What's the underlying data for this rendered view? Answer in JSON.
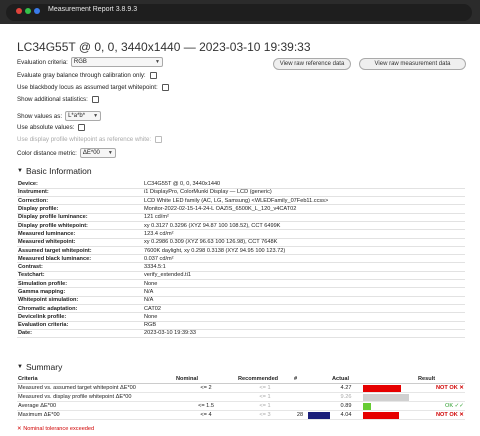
{
  "window": {
    "title": "Measurement Report 3.8.9.3"
  },
  "report_heading": "LC34G55T @ 0, 0, 3440x1440 — 2023-03-10 19:39:33",
  "controls": {
    "evaluation_criteria_label": "Evaluation criteria:",
    "evaluation_criteria_value": "RGB",
    "gray_balance_label": "Evaluate gray balance through calibration only:",
    "blackbody_label": "Use blackbody locus as assumed target whitepoint:",
    "additional_stats_label": "Show additional statistics:",
    "show_values_label": "Show values as:",
    "show_values_value": "L*a*b*",
    "absolute_values_label": "Use absolute values:",
    "display_profile_wp_label": "Use display profile whitepoint as reference white:",
    "distance_metric_label": "Color distance metric:",
    "distance_metric_value": "ΔE*00",
    "view_reference_btn": "View raw reference data",
    "view_measurement_btn": "View raw measurement data"
  },
  "basic_info": {
    "heading": "Basic Information",
    "rows": [
      {
        "key": "Device:",
        "value": "LC34G55T @ 0, 0, 3440x1440"
      },
      {
        "key": "Instrument:",
        "value": "i1 DisplayPro, ColorMunki Display — LCD (generic)"
      },
      {
        "key": "Correction:",
        "value": "LCD White LED family (AC, LG, Samsung) <WLEDFamily_07Feb11.ccss>"
      },
      {
        "key": "Display profile:",
        "value": "Monitor-2022-02-15-14-24-L OAZIS_6500K_L_120_v4CAT02"
      },
      {
        "key": "Display profile luminance:",
        "value": "121 cd/m²"
      },
      {
        "key": "Display profile whitepoint:",
        "value": "xy 0.3127 0.3296 (XYZ 94.87 100 108.52), CCT 6499K"
      },
      {
        "key": "Measured luminance:",
        "value": "123.4 cd/m²"
      },
      {
        "key": "Measured whitepoint:",
        "value": "xy 0.2986 0.309 (XYZ 96.63 100 126.98), CCT 7648K"
      },
      {
        "key": "Assumed target whitepoint:",
        "value": "7600K daylight, xy 0.298 0.3138 (XYZ 94.95 100 123.72)"
      },
      {
        "key": "Measured black luminance:",
        "value": "0.037 cd/m²"
      },
      {
        "key": "Contrast:",
        "value": "3334.5:1"
      },
      {
        "key": "Testchart:",
        "value": "verify_extended.ti1"
      },
      {
        "key": "Simulation profile:",
        "value": "None"
      },
      {
        "key": "Gamma mapping:",
        "value": "N/A"
      },
      {
        "key": "Whitepoint simulation:",
        "value": "N/A"
      },
      {
        "key": "Chromatic adaptation:",
        "value": "CAT02"
      },
      {
        "key": "Devicelink profile:",
        "value": "None"
      },
      {
        "key": "Evaluation criteria:",
        "value": "RGB"
      },
      {
        "key": "Date:",
        "value": "2023-03-10 19:39:33"
      }
    ]
  },
  "summary": {
    "heading": "Summary",
    "columns": [
      "Criteria",
      "Nominal",
      "Recommended",
      "#",
      "Actual",
      "Result"
    ],
    "bar_scale_max": 6,
    "rows": [
      {
        "criteria": "Measured vs. assumed target whitepoint ΔE*00",
        "nominal": "<= 2",
        "recommended": "<= 1",
        "count": "",
        "actual": "4.27",
        "actual_num": 4.27,
        "bar_color": "#e60000",
        "result": "NOT OK ✕",
        "ok": false,
        "grey_actual": false
      },
      {
        "criteria": "Measured vs. display profile whitepoint ΔE*00",
        "nominal": "",
        "recommended": "<= 1",
        "count": "",
        "actual": "9.26",
        "actual_num": 9.26,
        "bar_color": "#d0d0d0",
        "result": "",
        "ok": null,
        "grey_actual": true
      },
      {
        "criteria": "Average ΔE*00",
        "nominal": "<= 1.5",
        "recommended": "<= 1",
        "count": "",
        "actual": "0.89",
        "actual_num": 0.89,
        "bar_color": "#66cc33",
        "result": "OK ✓✓",
        "ok": true,
        "grey_actual": false
      },
      {
        "criteria": "Maximum ΔE*00",
        "nominal": "<= 4",
        "recommended": "<= 3",
        "count": "28",
        "actual": "4.04",
        "actual_num": 4.04,
        "bar_color": "#e60000",
        "result": "NOT OK ✕",
        "ok": false,
        "grey_actual": false,
        "swatch_color": "#1b1f7a"
      }
    ],
    "warning": "✕ Nominal tolerance exceeded"
  }
}
